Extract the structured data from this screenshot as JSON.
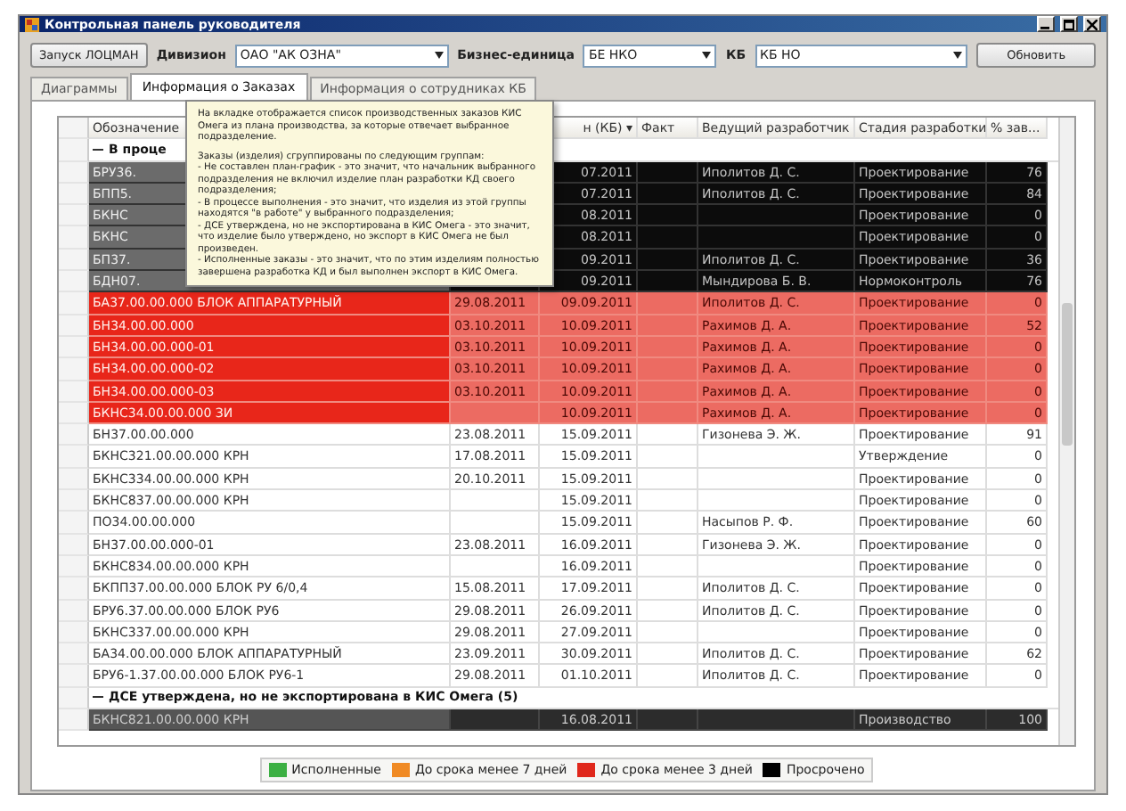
{
  "window": {
    "title": "Контрольная панель руководителя"
  },
  "toolbar": {
    "launch_button": "Запуск ЛОЦМАН",
    "division": {
      "label": "Дивизион",
      "value": "ОАО \"АК ОЗНА\""
    },
    "business_unit": {
      "label": "Бизнес-единица",
      "value": "БЕ НКО"
    },
    "kb": {
      "label": "КБ",
      "value": "КБ НО"
    },
    "refresh_button": "Обновить"
  },
  "tabs": [
    {
      "label": "Диаграммы",
      "selected": false
    },
    {
      "label": "Информация о Заказах",
      "selected": true
    },
    {
      "label": "Информация о сотрудниках КБ",
      "selected": false
    }
  ],
  "table": {
    "header": {
      "designation": "Обозначение",
      "kb_date": "н (КБ) ▾",
      "fact": "Факт",
      "developer": "Ведущий разработчик",
      "stage": "Стадия разработки",
      "percent": "% зав..."
    },
    "rows": [
      {
        "kind": "group",
        "label": "В проце"
      },
      {
        "kind": "overdue",
        "designation": "БРУ36.",
        "kb_date": "07.2011",
        "developer": "Иполитов Д. С.",
        "stage": "Проектирование",
        "percent": "76"
      },
      {
        "kind": "overdue",
        "designation": "БПП5.",
        "kb_date": "07.2011",
        "developer": "Иполитов Д. С.",
        "stage": "Проектирование",
        "percent": "84"
      },
      {
        "kind": "overdue",
        "designation": "БКНС",
        "kb_date": "08.2011",
        "stage": "Проектирование",
        "percent": "0"
      },
      {
        "kind": "overdue",
        "designation": "БКНС",
        "kb_date": "08.2011",
        "stage": "Проектирование",
        "percent": "0"
      },
      {
        "kind": "overdue",
        "designation": "БП37.",
        "kb_date": "09.2011",
        "developer": "Иполитов Д. С.",
        "stage": "Проектирование",
        "percent": "36"
      },
      {
        "kind": "overdue",
        "designation": "БДН07.",
        "kb_date": "09.2011",
        "developer": "Мындирова Б. В.",
        "stage": "Нормоконтроль",
        "percent": "76"
      },
      {
        "kind": "urgent",
        "designation": "БА37.00.00.000 БЛОК АППАРАТУРНЫЙ",
        "column_2": "29.08.2011",
        "kb_date": "09.09.2011",
        "developer": "Иполитов Д. С.",
        "stage": "Проектирование",
        "percent": "0"
      },
      {
        "kind": "urgent",
        "designation": "БН34.00.00.000",
        "column_2": "03.10.2011",
        "kb_date": "10.09.2011",
        "developer": "Рахимов Д. А.",
        "stage": "Проектирование",
        "percent": "52"
      },
      {
        "kind": "urgent",
        "designation": "БН34.00.00.000-01",
        "column_2": "03.10.2011",
        "kb_date": "10.09.2011",
        "developer": "Рахимов Д. А.",
        "stage": "Проектирование",
        "percent": "0"
      },
      {
        "kind": "urgent",
        "designation": "БН34.00.00.000-02",
        "column_2": "03.10.2011",
        "kb_date": "10.09.2011",
        "developer": "Рахимов Д. А.",
        "stage": "Проектирование",
        "percent": "0"
      },
      {
        "kind": "urgent",
        "designation": "БН34.00.00.000-03",
        "column_2": "03.10.2011",
        "kb_date": "10.09.2011",
        "developer": "Рахимов Д. А.",
        "stage": "Проектирование",
        "percent": "0"
      },
      {
        "kind": "urgent",
        "designation": "БКНС34.00.00.000 ЗИ",
        "kb_date": "10.09.2011",
        "developer": "Рахимов Д. А.",
        "stage": "Проектирование",
        "percent": "0"
      },
      {
        "kind": "normal",
        "designation": "БН37.00.00.000",
        "column_2": "23.08.2011",
        "kb_date": "15.09.2011",
        "developer": "Гизонева Э. Ж.",
        "stage": "Проектирование",
        "percent": "91"
      },
      {
        "kind": "normal",
        "designation": "БКНС321.00.00.000 КРН",
        "column_2": "17.08.2011",
        "kb_date": "15.09.2011",
        "stage": "Утверждение",
        "percent": "0"
      },
      {
        "kind": "normal",
        "designation": "БКНС334.00.00.000 КРН",
        "column_2": "20.10.2011",
        "kb_date": "15.09.2011",
        "stage": "Проектирование",
        "percent": "0"
      },
      {
        "kind": "normal",
        "designation": "БКНС837.00.00.000 КРН",
        "kb_date": "15.09.2011",
        "stage": "Проектирование",
        "percent": "0"
      },
      {
        "kind": "normal",
        "designation": "ПО34.00.00.000",
        "kb_date": "15.09.2011",
        "developer": "Насыпов Р. Ф.",
        "stage": "Проектирование",
        "percent": "60"
      },
      {
        "kind": "normal",
        "designation": "БН37.00.00.000-01",
        "column_2": "23.08.2011",
        "kb_date": "16.09.2011",
        "developer": "Гизонева Э. Ж.",
        "stage": "Проектирование",
        "percent": "0"
      },
      {
        "kind": "normal",
        "designation": "БКНС834.00.00.000 КРН",
        "kb_date": "16.09.2011",
        "stage": "Проектирование",
        "percent": "0"
      },
      {
        "kind": "normal",
        "designation": "БКПП37.00.00.000 БЛОК РУ 6/0,4",
        "column_2": "15.08.2011",
        "kb_date": "17.09.2011",
        "developer": "Иполитов Д. С.",
        "stage": "Проектирование",
        "percent": "0"
      },
      {
        "kind": "normal",
        "designation": "БРУ6.37.00.00.000 БЛОК РУ6",
        "column_2": "29.08.2011",
        "kb_date": "26.09.2011",
        "developer": "Иполитов Д. С.",
        "stage": "Проектирование",
        "percent": "0"
      },
      {
        "kind": "normal",
        "designation": "БКНС337.00.00.000 КРН",
        "column_2": "29.08.2011",
        "kb_date": "27.09.2011",
        "stage": "Проектирование",
        "percent": "0"
      },
      {
        "kind": "normal",
        "designation": "БА34.00.00.000 БЛОК АППАРАТУРНЫЙ",
        "column_2": "23.09.2011",
        "kb_date": "30.09.2011",
        "developer": "Иполитов Д. С.",
        "stage": "Проектирование",
        "percent": "62"
      },
      {
        "kind": "normal",
        "designation": "БРУ6-1.37.00.00.000 БЛОК РУ6-1",
        "column_2": "29.08.2011",
        "kb_date": "01.10.2011",
        "developer": "Иполитов Д. С.",
        "stage": "Проектирование",
        "percent": "0"
      },
      {
        "kind": "group",
        "label": "ДСЕ утверждена, но не экспортирована в КИС Омега (5)"
      },
      {
        "kind": "approved",
        "designation": "БКНС821.00.00.000 КРН",
        "kb_date": "16.08.2011",
        "stage": "Производство",
        "percent": "100"
      }
    ]
  },
  "tooltip": {
    "paragraphs": [
      "На вкладке отображается список производственных заказов КИС Омега из плана производства, за которые отвечает выбранное подразделение.",
      "Заказы (изделия) сгруппированы по следующим группам:\n- Не составлен план-график - это значит, что начальник выбранного подразделения не включил изделие план разработки КД своего подразделения;\n- В процессе выполнения - это значит, что изделия из этой группы находятся \"в работе\" у выбранного подразделения;\n- ДСЕ утверждена, но не экспортирована в КИС Омега - это значит, что изделие было утверждено, но экспорт в КИС Омега не был произведен.\n- Исполненные заказы - это значит, что по этим изделиям полностью завершена разработка КД и был выполнен экспорт в КИС Омега."
    ]
  },
  "legend": [
    {
      "label": "Исполненные",
      "color": "#3cb043"
    },
    {
      "label": "До срока менее 7 дней",
      "color": "#f08a24"
    },
    {
      "label": "До срока менее 3 дней",
      "color": "#e0281c"
    },
    {
      "label": "Просрочено",
      "color": "#000000"
    }
  ]
}
